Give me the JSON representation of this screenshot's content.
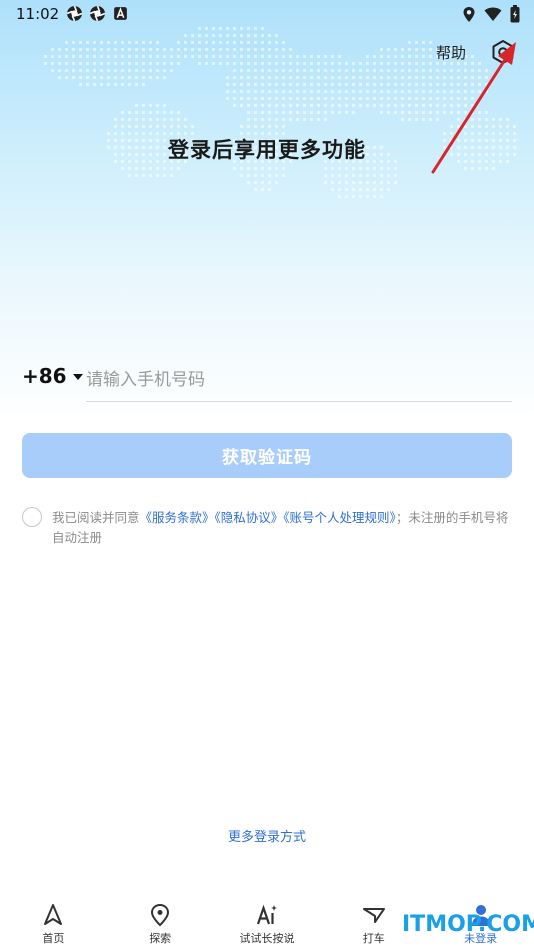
{
  "status_bar": {
    "time": "11:02"
  },
  "header": {
    "help_label": "帮助",
    "title": "登录后享用更多功能"
  },
  "login": {
    "country_code": "+86",
    "phone_placeholder": "请输入手机号码",
    "get_code_label": "获取验证码"
  },
  "agreement": {
    "prefix": "我已阅读并同意",
    "terms": "《服务条款》",
    "privacy": "《隐私协议》",
    "personal_rules": "《账号个人处理规则》",
    "suffix": "；未注册的手机号将自动注册"
  },
  "more_login": "更多登录方式",
  "nav": {
    "items": [
      {
        "label": "首页",
        "icon": "navigation-arrow-icon"
      },
      {
        "label": "探索",
        "icon": "location-pin-icon"
      },
      {
        "label": "试试长按说",
        "icon": "ai-sparkle-icon"
      },
      {
        "label": "打车",
        "icon": "taxi-icon"
      },
      {
        "label": "未登录",
        "icon": "user-icon"
      }
    ]
  },
  "watermark": "ITMOP.COM",
  "colors": {
    "accent": "#2f6fd6",
    "button_disabled": "#a9cdfa",
    "annotation_arrow": "#d9252a"
  }
}
